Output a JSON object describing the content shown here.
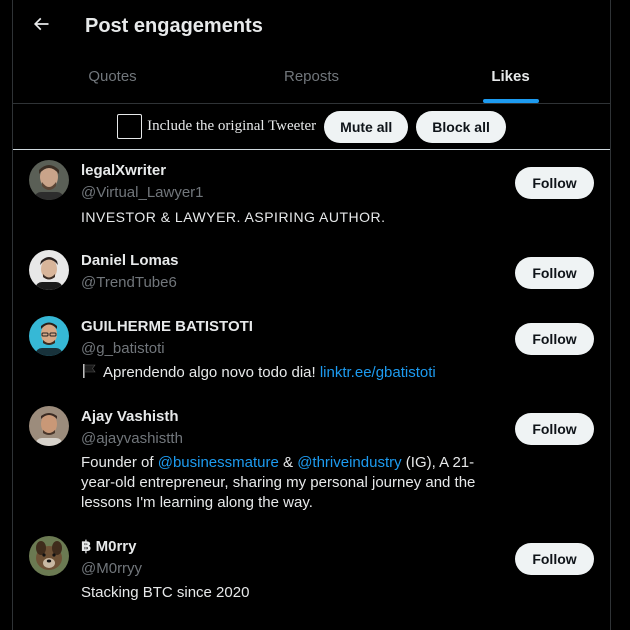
{
  "header": {
    "title": "Post engagements",
    "back_icon": "arrow-left-icon"
  },
  "tabs": [
    {
      "label": "Quotes",
      "active": false
    },
    {
      "label": "Reposts",
      "active": false
    },
    {
      "label": "Likes",
      "active": true
    }
  ],
  "toolbar": {
    "checkbox_label": "Include the original Tweeter",
    "checkbox_checked": false,
    "mute_all": "Mute all",
    "block_all": "Block all"
  },
  "users": [
    {
      "name": "legalXwriter",
      "handle": "@Virtual_Lawyer1",
      "bio": "INVESTOR & LAWYER. ASPIRING AUTHOR.",
      "follow": "Follow"
    },
    {
      "name": "Daniel Lomas",
      "handle": "@TrendTube6",
      "follow": "Follow"
    },
    {
      "name": "GUILHERME BATISTOTI",
      "handle": "@g_batistoti",
      "bio_text": "Aprendendo algo novo todo dia! ",
      "bio_link": "linktr.ee/gbatistoti",
      "bio_icon": "black-flag-icon",
      "follow": "Follow"
    },
    {
      "name": "Ajay Vashisth",
      "handle": "@ajayvashistth",
      "bio_parts": {
        "p1": "Founder of ",
        "m1": "@businessmature",
        "p2": " & ",
        "m2": "@thriveindustry",
        "p3": " (IG), A 21-year-old entrepreneur, sharing my personal journey and the lessons I'm learning along the way."
      },
      "follow": "Follow"
    },
    {
      "name": "฿ M0rry",
      "handle": "@M0rryy",
      "bio": "Stacking BTC since 2020",
      "follow": "Follow"
    }
  ],
  "colors": {
    "accent": "#1d9bf0",
    "background": "#000000",
    "muted": "#71767b",
    "button_bg": "#eff3f4"
  }
}
